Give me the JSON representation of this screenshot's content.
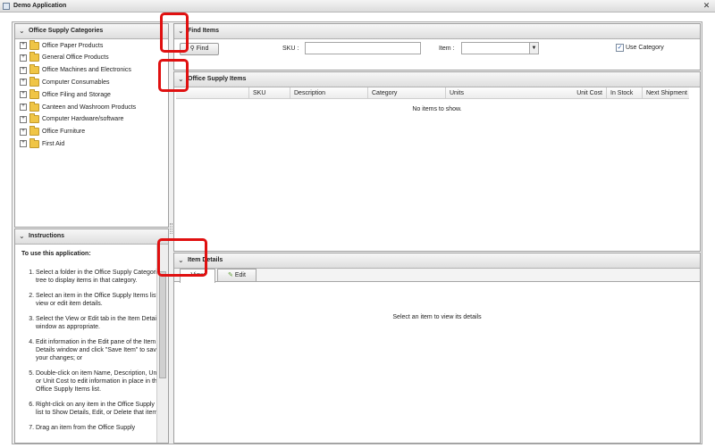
{
  "window": {
    "title": "Demo Application",
    "close_glyph": "✕"
  },
  "categories_panel": {
    "title": "Office Supply Categories",
    "items": [
      {
        "label": "Office Paper Products"
      },
      {
        "label": "General Office Products"
      },
      {
        "label": "Office Machines and Electronics"
      },
      {
        "label": "Computer Consumables"
      },
      {
        "label": "Office Filing and Storage"
      },
      {
        "label": "Canteen and Washroom Products"
      },
      {
        "label": "Computer Hardware/software"
      },
      {
        "label": "Office Furniture"
      },
      {
        "label": "First Aid"
      }
    ]
  },
  "instructions_panel": {
    "title": "Instructions",
    "heading": "To use this application:",
    "steps": [
      "Select a folder in the Office Supply Categories tree to display items in that category.",
      "Select an item in the Office Supply Items list to view or edit item details.",
      "Select the View or Edit tab in the Item Details window as appropriate.",
      "Edit information in the Edit pane of the Item Details window and click \"Save Item\" to save your changes; or",
      "Double-click on item Name, Description, Units, or Unit Cost to edit information in place in the Office Supply Items list.",
      "Right-click on any item in the Office Supply Items list to Show Details, Edit, or Delete that item.",
      "Drag an item from the Office Supply"
    ]
  },
  "find_panel": {
    "title": "Find Items",
    "find_button": "Find",
    "sku_label": "SKU :",
    "sku_value": "",
    "item_label": "Item :",
    "item_value": "",
    "use_category_label": "Use Category",
    "use_category_checked": true
  },
  "items_panel": {
    "title": "Office Supply Items",
    "columns": [
      "",
      "SKU",
      "Description",
      "Category",
      "Units",
      "Unit Cost",
      "In Stock",
      "Next Shipment"
    ],
    "empty_message": "No items to show."
  },
  "details_panel": {
    "title": "Item Details",
    "tabs": [
      {
        "label": "View"
      },
      {
        "label": "Edit"
      }
    ],
    "empty_message": "Select an item to view its details"
  },
  "colors": {
    "annotation": "#e01010",
    "folder": "#f0c545"
  }
}
